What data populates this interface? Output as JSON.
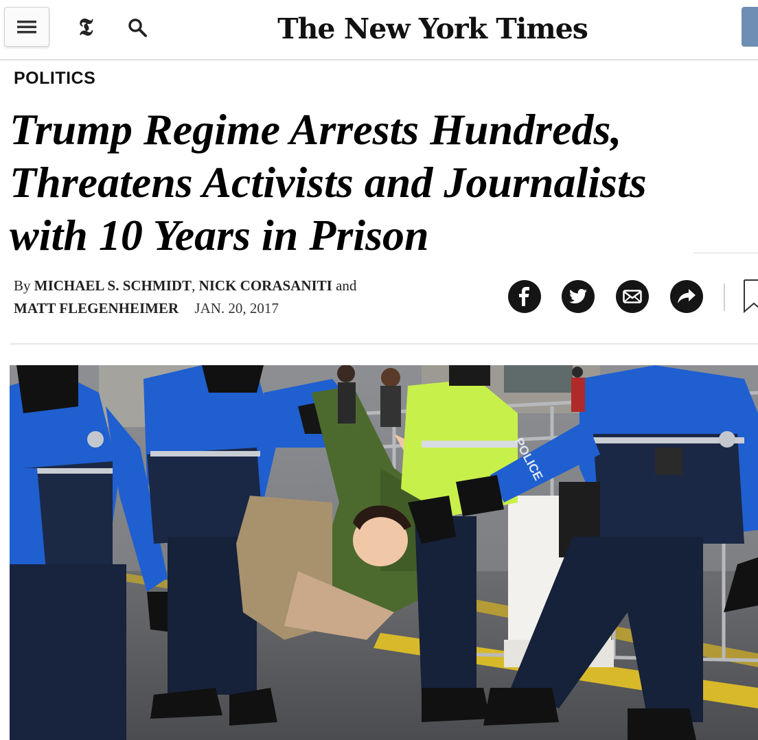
{
  "header": {
    "masthead": "The New York Times",
    "t_logo": "𝕿",
    "menu_icon": "hamburger-menu-icon",
    "search_icon": "search-icon"
  },
  "article": {
    "section": "POLITICS",
    "headline_lines": [
      "Trump Regime Arrests Hundreds,",
      "Threatens Activists and Journalists",
      "with 10 Years in Prison"
    ],
    "byline": {
      "prefix": "By",
      "author1": "MICHAEL S. SCHMIDT",
      "sep1": ",",
      "author2": "NICK CORASANITI",
      "and": "and",
      "author3": "MATT FLEGENHEIMER",
      "date": "JAN. 20, 2017"
    }
  },
  "share": {
    "icons": [
      "facebook-icon",
      "twitter-icon",
      "email-icon",
      "share-icon",
      "bookmark-icon"
    ]
  },
  "photo": {
    "subject": "Police officers carrying a protester in a green jacket",
    "police_badge_text": "POLICE"
  },
  "colors": {
    "share_bg": "#151515",
    "police_blue": "#1f5fcf",
    "hi_vis": "#c8f04a",
    "jacket_green": "#4d6a2e",
    "subscribe_blue": "#6e8eb3"
  }
}
